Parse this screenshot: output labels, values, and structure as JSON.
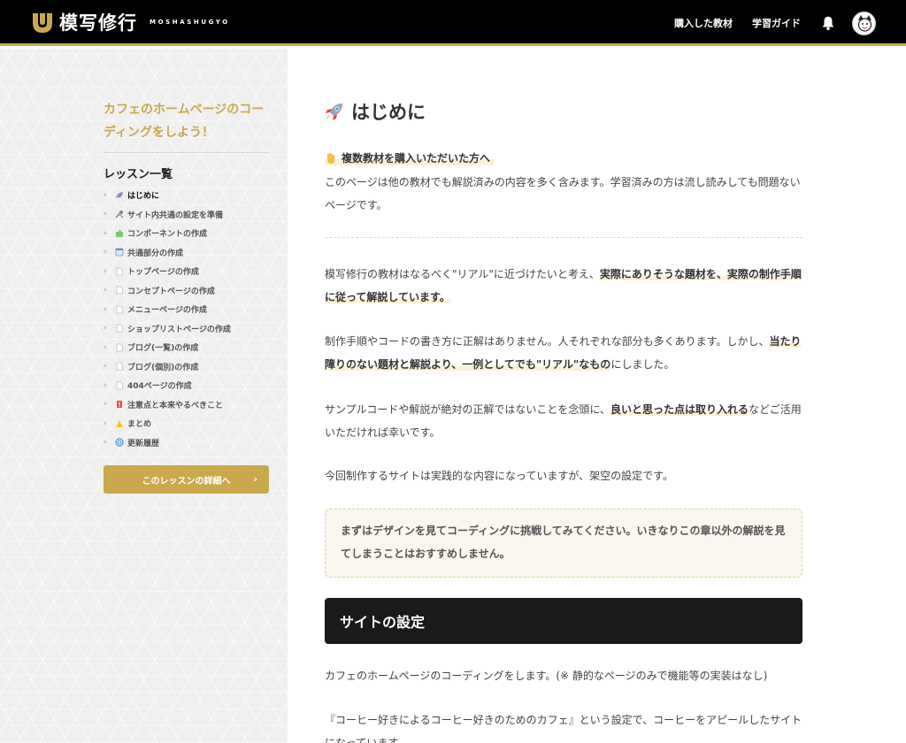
{
  "header": {
    "logo_jp": "模写修行",
    "logo_en": "MOSHASHUGYO",
    "nav": [
      "購入した教材",
      "学習ガイド"
    ],
    "bell_icon": "bell-icon",
    "avatar_icon": "user-avatar"
  },
  "sidebar": {
    "course_title": "カフェのホームページのコーディングをしよう！",
    "lesson_heading": "レッスン一覧",
    "lessons": [
      {
        "icon": "rocket-icon",
        "label": "はじめに"
      },
      {
        "icon": "tools-icon",
        "label": "サイト内共通の設定を準備"
      },
      {
        "icon": "puzzle-icon",
        "label": "コンポーネントの作成"
      },
      {
        "icon": "window-icon",
        "label": "共通部分の作成"
      },
      {
        "icon": "page-icon",
        "label": "トップページの作成"
      },
      {
        "icon": "page-icon",
        "label": "コンセプトページの作成"
      },
      {
        "icon": "page-icon",
        "label": "メニューページの作成"
      },
      {
        "icon": "page-icon",
        "label": "ショップリストページの作成"
      },
      {
        "icon": "page-icon",
        "label": "ブログ(一覧)の作成"
      },
      {
        "icon": "page-icon",
        "label": "ブログ(個別)の作成"
      },
      {
        "icon": "page-icon",
        "label": "404ページの作成"
      },
      {
        "icon": "warning-icon",
        "label": "注意点と本来やるべきこと"
      },
      {
        "icon": "pray-icon",
        "label": "まとめ"
      },
      {
        "icon": "refresh-icon",
        "label": "更新履歴"
      }
    ],
    "detail_button": "このレッスンの詳細へ",
    "detail_arrow": "›",
    "chevron": "›"
  },
  "main": {
    "title": "はじめに",
    "notice_heading": "複数教材を購入いただいた方へ",
    "notice_text": "このページは他の教材でも解説済みの内容を多く含みます。学習済みの方は流し読みしても問題ないページです。",
    "p1_a": "模写修行の教材はなるべく\"リアル\"に近づけたいと考え、",
    "p1_b": "実際にありそうな題材を、実際の制作手順に従って解説しています。",
    "p2_a": "制作手順やコードの書き方に正解はありません。人それぞれな部分も多くあります。しかし、",
    "p2_b": "当たり障りのない題材と解説より、一例としてでも\"リアル\"なもの",
    "p2_c": "にしました。",
    "p3_a": "サンプルコードや解説が絶対の正解ではないことを念頭に、",
    "p3_b": "良いと思った点は取り入れる",
    "p3_c": "などご活用いただければ幸いです。",
    "p4": "今回制作するサイトは実践的な内容になっていますが、架空の設定です。",
    "note": "まずはデザインを見てコーディングに挑戦してみてください。いきなりこの章以外の解説を見てしまうことはおすすめしません。",
    "section_title": "サイトの設定",
    "p5": "カフェのホームページのコーディングをします。(※ 静的なページのみで機能等の実装はなし)",
    "p6": "『コーヒー好きによるコーヒー好きのためのカフェ』という設定で、コーヒーをアピールしたサイトになっています。"
  },
  "colors": {
    "accent": "#c9a94b",
    "header_bg": "#000000",
    "section_bg": "#1a1a1a"
  }
}
